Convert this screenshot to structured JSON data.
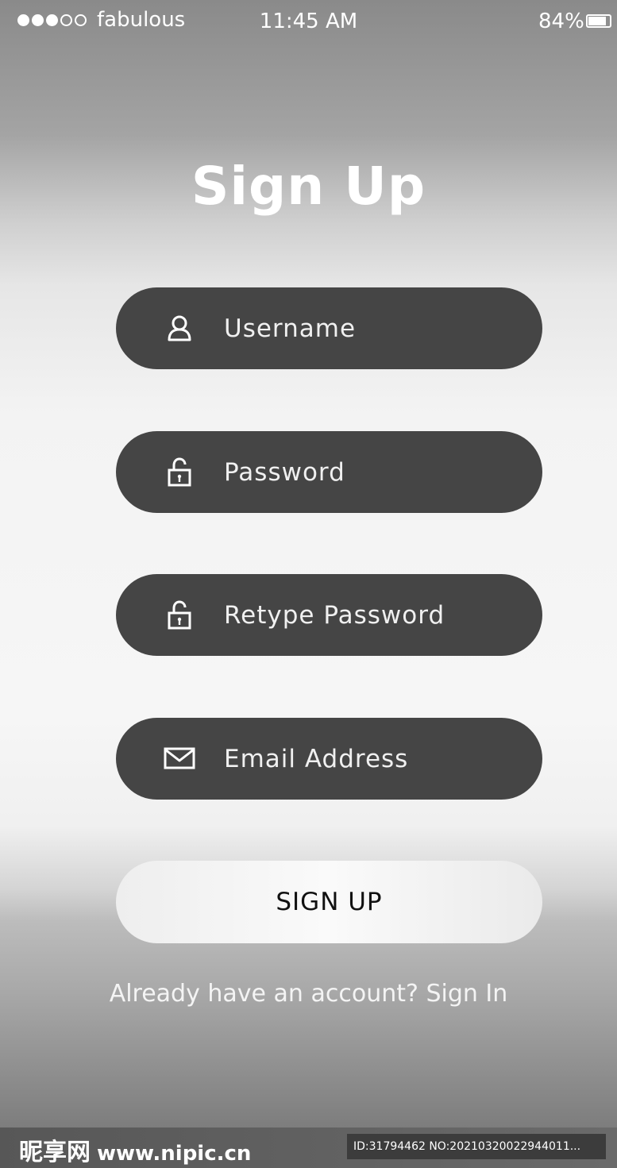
{
  "status_bar": {
    "signal_dots": [
      "filled",
      "filled",
      "filled",
      "empty",
      "empty"
    ],
    "carrier": "fabulous",
    "time": "11:45 AM",
    "battery": "84%"
  },
  "title": "Sign Up",
  "fields": {
    "username": {
      "placeholder": "Username",
      "icon": "user-icon"
    },
    "password": {
      "placeholder": "Password",
      "icon": "padlock-icon"
    },
    "retype_password": {
      "placeholder": "Retype Password",
      "icon": "padlock-icon"
    },
    "email": {
      "placeholder": "Email Address",
      "icon": "envelope-icon"
    }
  },
  "signup_button": {
    "label": "SIGN UP"
  },
  "signin": {
    "prompt": "Already have an account?",
    "link": "Sign In"
  },
  "footer": {
    "logo_zh": "昵享网",
    "logo_url": "www.nipic.cn",
    "id_text": "ID:31794462 NO:20210320022944011..."
  },
  "colors": {
    "field_bg": "#454545",
    "button_bg": "#f2f2f2",
    "text_light": "#ffffff"
  }
}
